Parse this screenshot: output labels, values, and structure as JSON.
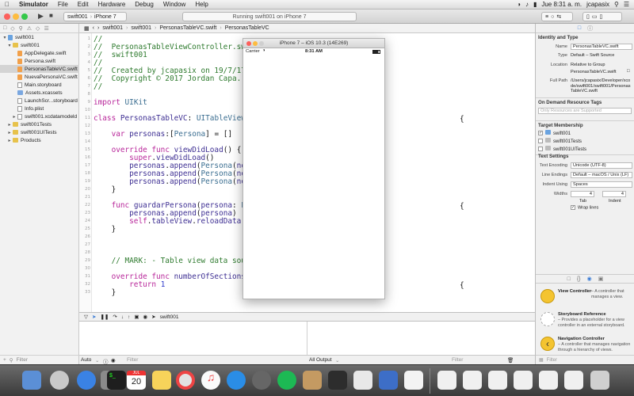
{
  "menubar": {
    "apple": "",
    "items": [
      "Simulator",
      "File",
      "Edit",
      "Hardware",
      "Debug",
      "Window",
      "Help"
    ],
    "clock": "Jue 8:31 a. m.",
    "user": "jcapasix"
  },
  "toolbar": {
    "scheme": "swift001",
    "device": "iPhone 7",
    "status": "Running swift001 on iPhone 7"
  },
  "jumpbar": [
    "swift001",
    "swift001",
    "PersonasTableVC.swift",
    "PersonasTableVC"
  ],
  "navigator": {
    "items": [
      {
        "label": "swift001",
        "kind": "project"
      },
      {
        "label": "swift001",
        "kind": "folder"
      },
      {
        "label": "AppDelegate.swift",
        "kind": "swift"
      },
      {
        "label": "Persona.swift",
        "kind": "swift"
      },
      {
        "label": "PersonasTableVC.swift",
        "kind": "swift",
        "selected": true
      },
      {
        "label": "NuevaPersonaVC.swift",
        "kind": "swift"
      },
      {
        "label": "Main.storyboard",
        "kind": "storyboard"
      },
      {
        "label": "Assets.xcassets",
        "kind": "assets"
      },
      {
        "label": "LaunchScr...storyboard",
        "kind": "storyboard"
      },
      {
        "label": "Info.plist",
        "kind": "plist"
      },
      {
        "label": "swift001.xcdatamodeld",
        "kind": "data"
      },
      {
        "label": "swift001Tests",
        "kind": "folder"
      },
      {
        "label": "swift001UITests",
        "kind": "folder"
      },
      {
        "label": "Products",
        "kind": "folder"
      }
    ],
    "filter_placeholder": "Filter"
  },
  "editor": {
    "lines": [
      {
        "n": "1",
        "text": "//"
      },
      {
        "n": "2",
        "text": "//  PersonasTableViewController.swift"
      },
      {
        "n": "3",
        "text": "//  swift001"
      },
      {
        "n": "4",
        "text": "//"
      },
      {
        "n": "5",
        "text": "//  Created by jcapasix on 19/7/17."
      },
      {
        "n": "6",
        "text": "//  Copyright © 2017 Jordan Capa. All"
      },
      {
        "n": "7",
        "text": "//"
      },
      {
        "n": "8",
        "text": ""
      },
      {
        "n": "9",
        "text": "import UIKit"
      },
      {
        "n": "10",
        "text": ""
      },
      {
        "n": "11",
        "text": "class PersonasTableVC: UITableViewCo"
      },
      {
        "n": "12",
        "text": ""
      },
      {
        "n": "13",
        "text": "    var personas:[Persona] = []"
      },
      {
        "n": "14",
        "text": ""
      },
      {
        "n": "15",
        "text": "    override func viewDidLoad() {"
      },
      {
        "n": "16",
        "text": "        super.viewDidLoad()"
      },
      {
        "n": "17",
        "text": "        personas.append(Persona(nomb"
      },
      {
        "n": "18",
        "text": "        personas.append(Persona(nomb"
      },
      {
        "n": "19",
        "text": "        personas.append(Persona(nomb"
      },
      {
        "n": "20",
        "text": "    }"
      },
      {
        "n": "21",
        "text": ""
      },
      {
        "n": "22",
        "text": "    func guardarPersona(persona: Per"
      },
      {
        "n": "23",
        "text": "        personas.append(persona)"
      },
      {
        "n": "24",
        "text": "        self.tableView.reloadData()"
      },
      {
        "n": "25",
        "text": "    }"
      },
      {
        "n": "26",
        "text": ""
      },
      {
        "n": "27",
        "text": ""
      },
      {
        "n": "28",
        "text": ""
      },
      {
        "n": "29",
        "text": "    // MARK: - Table view data source"
      },
      {
        "n": "30",
        "text": ""
      },
      {
        "n": "31",
        "text": "    override func numberOfSections(i"
      },
      {
        "n": "32",
        "text": "        return 1"
      },
      {
        "n": "33",
        "text": "    }"
      }
    ],
    "brace_11": "{",
    "brace_22": "{",
    "brace_31": "{"
  },
  "debug": {
    "target": "swift001",
    "auto_label": "Auto",
    "all_output_label": "All Output",
    "filter_placeholder": "Filter"
  },
  "simulator": {
    "title": "iPhone 7 – iOS 10.3 (14E269)",
    "carrier": "Carrier",
    "time": "8:31 AM"
  },
  "inspector": {
    "identity_header": "Identity and Type",
    "name_label": "Name",
    "name_value": "PersonasTableVC.swift",
    "type_label": "Type",
    "type_value": "Default – Swift Source",
    "location_label": "Location",
    "location_value": "Relative to Group",
    "location_file": "PersonasTableVC.swift",
    "fullpath_label": "Full Path",
    "fullpath_value": "/Users/jcapasix/Developer/xcode/swift001/swift001/PersonasTableVC.swift",
    "odr_header": "On Demand Resource Tags",
    "odr_placeholder": "Only Resources are Supported",
    "target_header": "Target Membership",
    "targets": [
      {
        "label": "swift001",
        "checked": true
      },
      {
        "label": "swift001Tests",
        "checked": false
      },
      {
        "label": "swift001UITests",
        "checked": false
      }
    ],
    "text_header": "Text Settings",
    "encoding_label": "Text Encoding",
    "encoding_value": "Unicode (UTF-8)",
    "line_endings_label": "Line Endings",
    "line_endings_value": "Default – macOS / Unix (LF)",
    "indent_label": "Indent Using",
    "indent_value": "Spaces",
    "widths_label": "Widths",
    "tab_value": "4",
    "indent_value_num": "4",
    "tab_label": "Tab",
    "indent_sub_label": "Indent",
    "wrap_label": "Wrap lines",
    "library": [
      {
        "title": "View Controller",
        "desc": "– A controller that manages a view."
      },
      {
        "title": "Storyboard Reference",
        "desc": "– Provides a placeholder for a view controller in an external storyboard."
      },
      {
        "title": "Navigation Controller",
        "desc": "– A controller that manages navigation through a hierarchy of views."
      }
    ],
    "filter_placeholder": "Filter"
  },
  "dock": {
    "calendar_month": "JUL",
    "calendar_day": "20"
  }
}
